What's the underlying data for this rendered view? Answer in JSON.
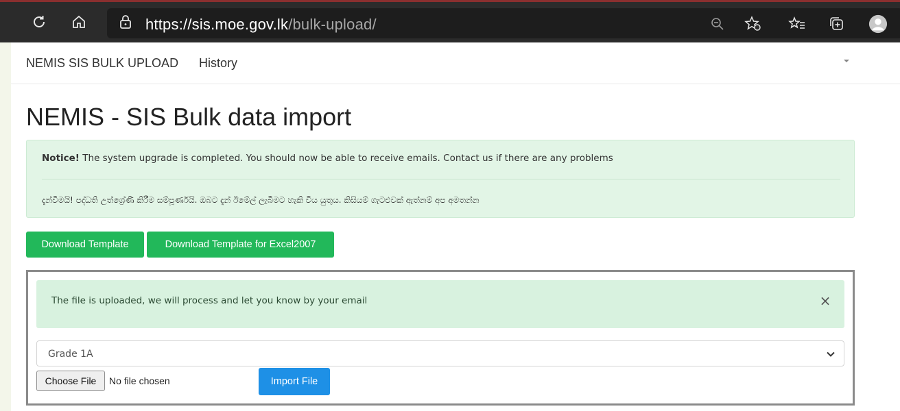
{
  "browser": {
    "url_host": "https://sis.moe.gov.lk",
    "url_path": "/bulk-upload/"
  },
  "navbar": {
    "brand": "NEMIS SIS BULK UPLOAD",
    "history": "History"
  },
  "main": {
    "title": "NEMIS - SIS Bulk data import",
    "notice": {
      "label": "Notice!",
      "text_en": " The system upgrade is completed. You should now be able to receive emails. Contact us if there are any problems",
      "text_si": "දැන්වීමයි! පද්ධති උත්ශ්‍රේණි කිරීම සම්පූර්ණයි. ඔබට දැන් ඊමේල් ලැබීමට හැකි විය යුතුය. කිසියම් ගැටළුවක් ඇත්නම් අප අමතන්න"
    },
    "buttons": {
      "download_template": "Download Template",
      "download_template_excel": "Download Template for Excel2007"
    },
    "upload": {
      "success_message": "The file is uploaded, we will process and let you know by your email",
      "close_symbol": "×",
      "grade_selected": "Grade 1A",
      "choose_file": "Choose File",
      "file_status": "No file chosen",
      "import_button": "Import File"
    }
  },
  "colors": {
    "green_button": "#22b85a",
    "import_button": "#1e90e6",
    "notice_bg": "#e2f5e6"
  }
}
